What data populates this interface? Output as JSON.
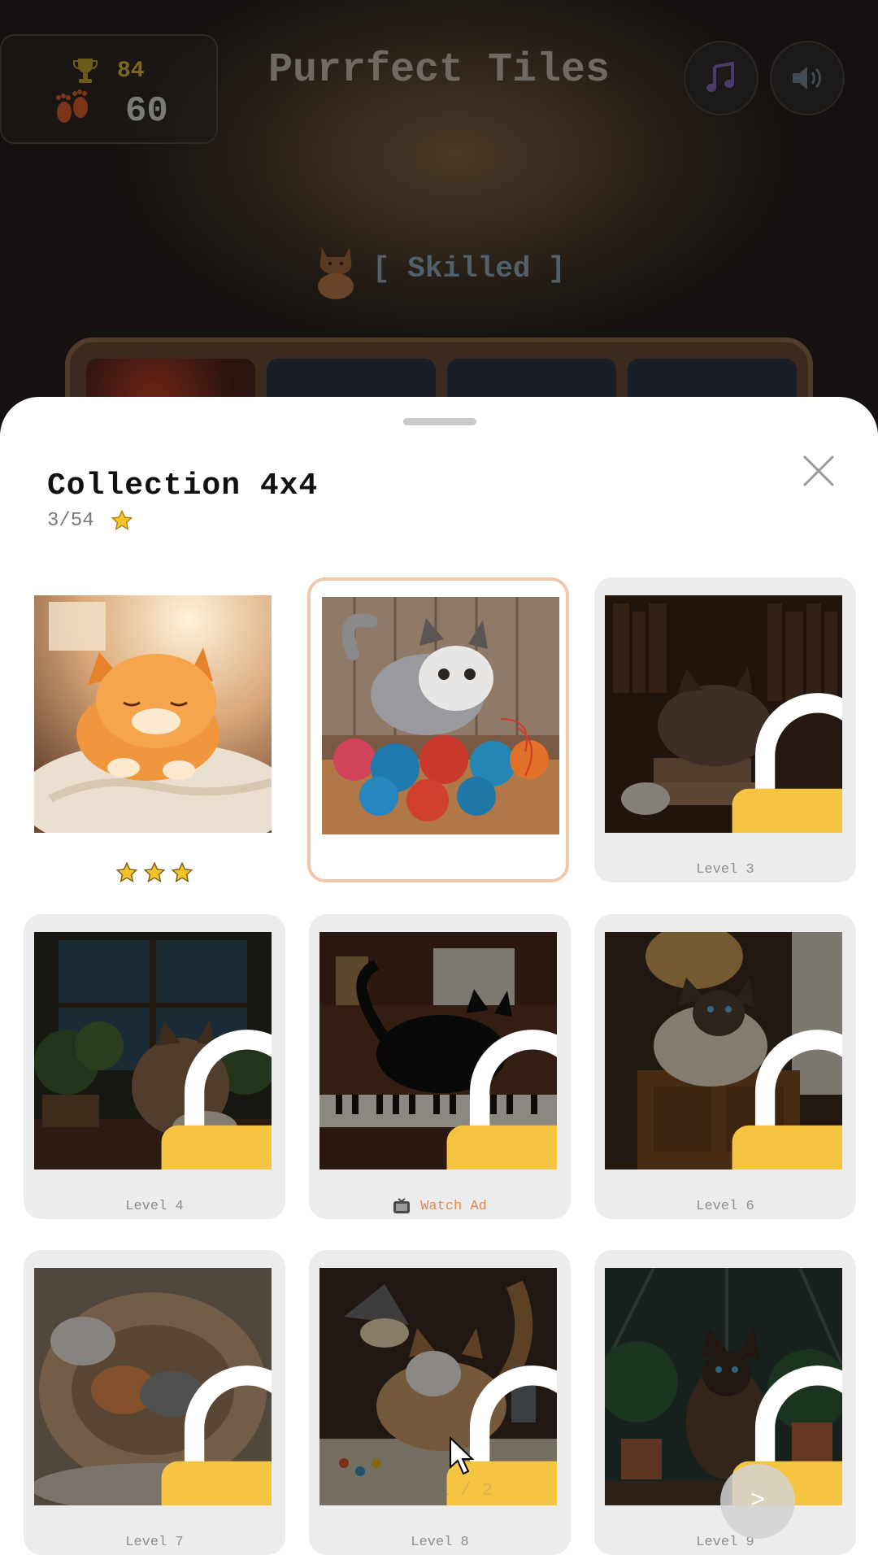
{
  "header": {
    "best_score": "84",
    "moves": "60",
    "title": "Purrfect Tiles",
    "rank": "[ Skilled ]"
  },
  "icons": {
    "trophy": "trophy-icon",
    "moves": "paw-footprints-icon",
    "music": "music-note-icon",
    "sound": "speaker-icon",
    "close": "close-icon",
    "lock": "padlock-icon",
    "ad": "tv-icon",
    "next": "chevron-right"
  },
  "colors": {
    "accent_orange": "#e08a4e",
    "star_gold": "#f5c228",
    "lock_yellow": "#f5c542",
    "selected_border": "#f0c7a8"
  },
  "collection": {
    "title": "Collection 4x4",
    "progress": "3/54",
    "items": [
      {
        "name": "Sunlit orange kitten",
        "status": "completed",
        "stars": 3
      },
      {
        "name": "Tabby with yarn",
        "status": "selected"
      },
      {
        "name": "Cat in library",
        "status": "locked",
        "label": "Level 3"
      },
      {
        "name": "Calico by window",
        "status": "locked",
        "label": "Level 4"
      },
      {
        "name": "Black cat on piano",
        "status": "locked",
        "label": "Watch Ad"
      },
      {
        "name": "Siamese on cabinet",
        "status": "locked",
        "label": "Level 6"
      },
      {
        "name": "Kittens in bed",
        "status": "locked",
        "label": "Level 7"
      },
      {
        "name": "Cat with paints",
        "status": "locked",
        "label": "Level 8"
      },
      {
        "name": "Siamese in greenhouse",
        "status": "locked",
        "label": "Level 9"
      }
    ],
    "page_indicator": "Page 1 / 2",
    "next_label": ">"
  }
}
